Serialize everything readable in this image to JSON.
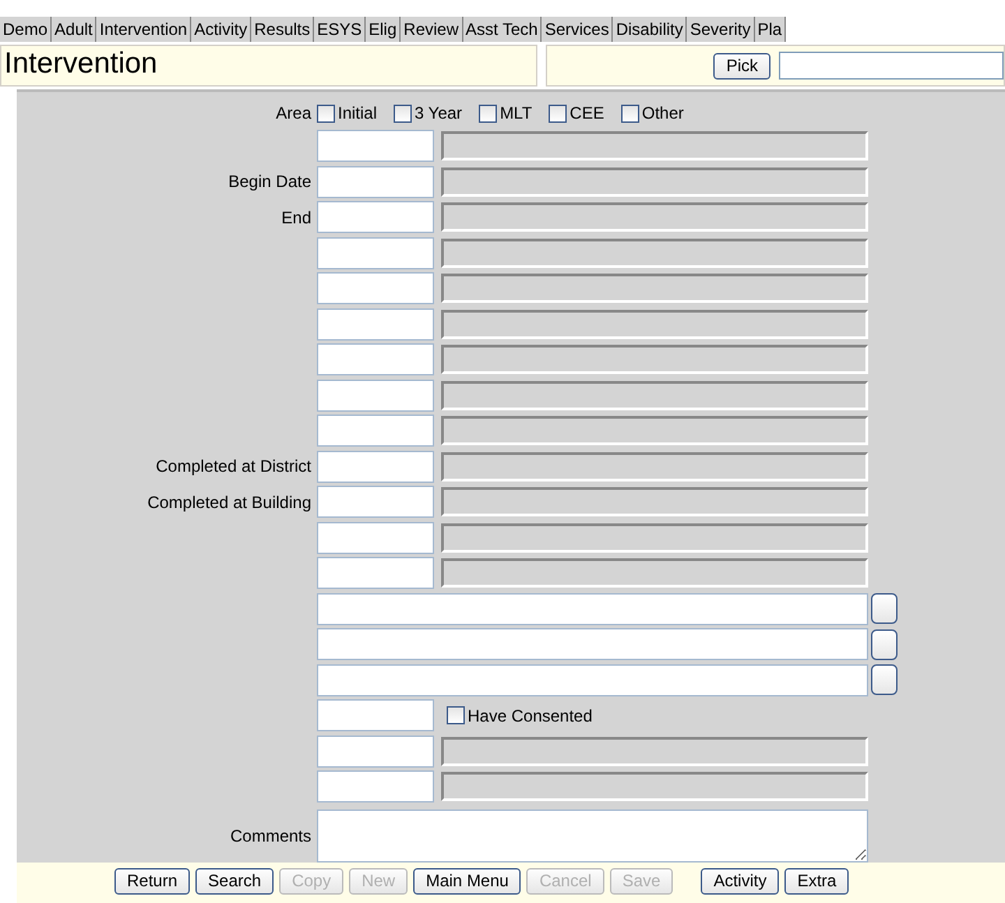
{
  "tabs": [
    {
      "label": "Demo"
    },
    {
      "label": "Adult"
    },
    {
      "label": "Intervention"
    },
    {
      "label": "Activity"
    },
    {
      "label": "Results"
    },
    {
      "label": "ESYS"
    },
    {
      "label": "Elig"
    },
    {
      "label": "Review"
    },
    {
      "label": "Asst Tech"
    },
    {
      "label": "Services"
    },
    {
      "label": "Disability"
    },
    {
      "label": "Severity"
    },
    {
      "label": "Pla"
    }
  ],
  "header": {
    "title": "Intervention",
    "pick_button": "Pick"
  },
  "area": {
    "label": "Area",
    "options": [
      {
        "label": "Initial",
        "checked": false
      },
      {
        "label": "3 Year",
        "checked": false
      },
      {
        "label": "MLT",
        "checked": false
      },
      {
        "label": "CEE",
        "checked": false
      },
      {
        "label": "Other",
        "checked": false
      }
    ]
  },
  "rows": [
    {
      "kind": "pair"
    },
    {
      "kind": "pair",
      "label": "Begin Date"
    },
    {
      "kind": "pair",
      "label": "End"
    },
    {
      "kind": "pair"
    },
    {
      "kind": "pair"
    },
    {
      "kind": "pair"
    },
    {
      "kind": "pair"
    },
    {
      "kind": "pair"
    },
    {
      "kind": "pair"
    },
    {
      "kind": "pair",
      "label": "Completed at District"
    },
    {
      "kind": "pair",
      "label": "Completed at Building"
    },
    {
      "kind": "pair"
    },
    {
      "kind": "pair"
    },
    {
      "kind": "long"
    },
    {
      "kind": "long"
    },
    {
      "kind": "long"
    },
    {
      "kind": "check",
      "check_label": "Have Consented",
      "checked": false
    },
    {
      "kind": "pair"
    },
    {
      "kind": "pair"
    },
    {
      "kind": "memo",
      "label": "Comments"
    }
  ],
  "button_groups": [
    {
      "buttons": [
        {
          "label": "Return",
          "disabled": false
        },
        {
          "label": "Search",
          "disabled": false
        },
        {
          "label": "Copy",
          "disabled": true
        },
        {
          "label": "New",
          "disabled": true
        },
        {
          "label": "Main Menu",
          "disabled": false
        },
        {
          "label": "Cancel",
          "disabled": true
        },
        {
          "label": "Save",
          "disabled": true
        }
      ]
    },
    {
      "buttons": [
        {
          "label": "Activity",
          "disabled": false
        },
        {
          "label": "Extra",
          "disabled": false
        }
      ]
    }
  ]
}
